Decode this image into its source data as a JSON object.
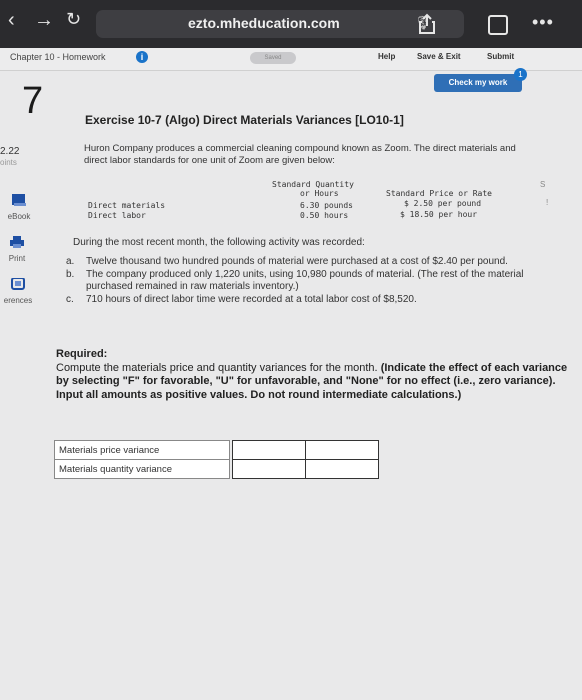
{
  "browser": {
    "url": "ezto.mheducation.com",
    "tabs_count": ""
  },
  "header": {
    "chapter": "Chapter 10 - Homework",
    "info_icon": "i",
    "saved": "Saved",
    "help": "Help",
    "save_exit": "Save & Exit",
    "submit": "Submit",
    "check_button": "Check my work",
    "check_badge": "1"
  },
  "rail": {
    "question_number": "7",
    "points_value": "2.22",
    "points_label": "oints",
    "ebook": "eBook",
    "print": "Print",
    "references": "erences"
  },
  "exercise": {
    "title": "Exercise 10-7 (Algo) Direct Materials Variances [LO10-1]",
    "intro": "Huron Company produces a commercial cleaning compound known as Zoom. The direct materials and direct labor standards for one unit of Zoom are given below:",
    "std_header_qty_1": "Standard Quantity",
    "std_header_qty_2": "or Hours",
    "std_header_price": "Standard Price or Rate",
    "row1_label": "Direct materials",
    "row1_qty": "6.30 pounds",
    "row1_price": "$ 2.50 per pound",
    "row2_label": "Direct labor",
    "row2_qty": "0.50 hours",
    "row2_price": "$ 18.50 per hour",
    "edge_dollar": "S",
    "edge_bang": "!",
    "during": "During the most recent month, the following activity was recorded:",
    "items": [
      {
        "marker": "a.",
        "text": "Twelve thousand two hundred pounds of material were purchased at a cost of $2.40 per pound."
      },
      {
        "marker": "b.",
        "text": "The company produced only 1,220 units, using 10,980 pounds of material. (The rest of the material purchased remained in raw materials inventory.)"
      },
      {
        "marker": "c.",
        "text": "710 hours of direct labor time were recorded at a total labor cost of $8,520."
      }
    ],
    "required_head": "Required:",
    "required_text": "Compute the materials price and quantity variances for the month.",
    "required_bold": "(Indicate the effect of each variance by selecting \"F\" for favorable, \"U\" for unfavorable, and \"None\" for no effect (i.e., zero variance). Input all amounts as positive values. Do not round intermediate calculations.)",
    "answer_rows": [
      {
        "label": "Materials price variance"
      },
      {
        "label": "Materials quantity variance"
      }
    ]
  }
}
